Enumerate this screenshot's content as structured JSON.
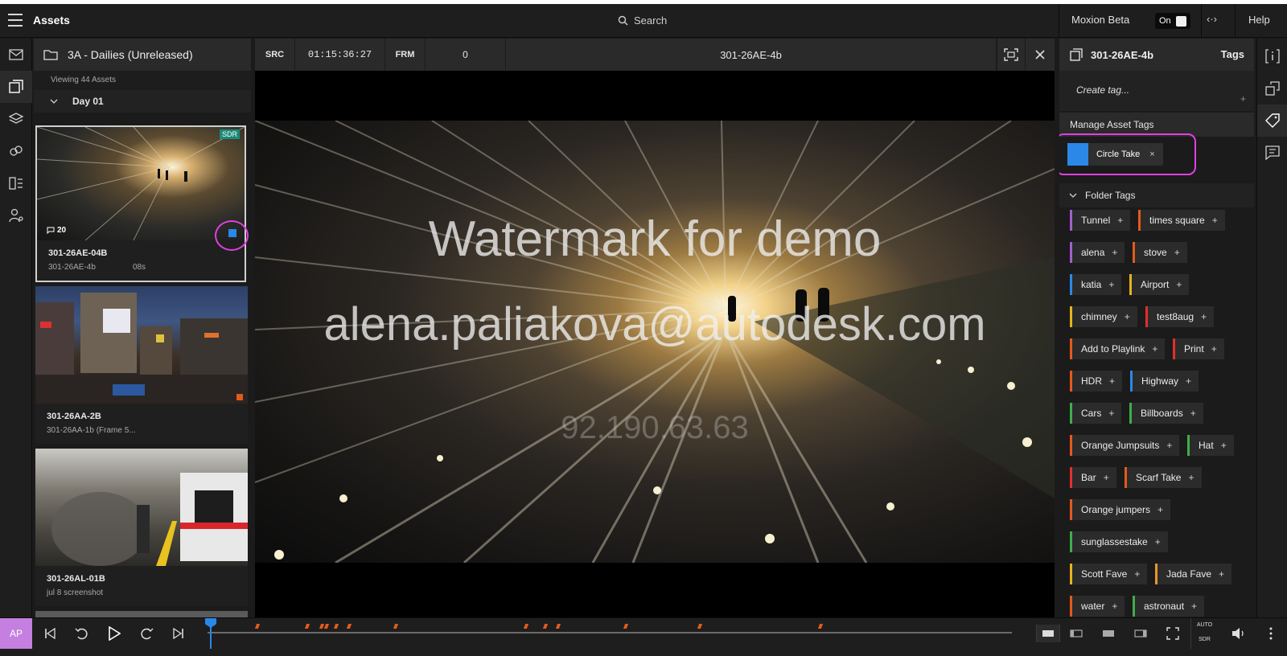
{
  "topbar": {
    "title": "Assets",
    "search_placeholder": "Search",
    "moxion_label": "Moxion Beta",
    "toggle_label": "On",
    "code_glyph": "‹·›",
    "help_label": "Help"
  },
  "assets_panel": {
    "folder_title": "3A - Dailies (Unreleased)",
    "viewing_text": "Viewing 44 Assets",
    "day_label": "Day 01",
    "cards": [
      {
        "name": "301-26AE-04B",
        "sub": "301-26AE-4b",
        "duration": "08s",
        "badge": "SDR",
        "comments": "20"
      },
      {
        "name": "301-26AA-2B",
        "sub": "301-26AA-1b (Frame 5...",
        "duration": ""
      },
      {
        "name": "301-26AL-01B",
        "sub": "jul 8 screenshot",
        "duration": ""
      }
    ]
  },
  "viewer": {
    "src_label": "SRC",
    "timecode": "01:15:36:27",
    "frm_label": "FRM",
    "frame_value": "0",
    "asset_name": "301-26AE-4b",
    "watermark_line1": "Watermark for demo",
    "watermark_line2": "alena.paliakova@autodesk.com",
    "watermark_ip": "92.190.63.63"
  },
  "tags_panel": {
    "asset_name": "301-26AE-4b",
    "tab_label": "Tags",
    "create_placeholder": "Create tag...",
    "create_plus": "+",
    "manage_label": "Manage Asset Tags",
    "asset_tag": {
      "name": "Circle Take",
      "color": "#2b88e8",
      "remove": "×"
    },
    "folder_tags_label": "Folder Tags",
    "folder_tags": [
      {
        "name": "Tunnel",
        "color": "#a35fd0"
      },
      {
        "name": "times square",
        "color": "#e45a1c"
      },
      {
        "name": "alena",
        "color": "#a35fd0"
      },
      {
        "name": "stove",
        "color": "#e45a1c"
      },
      {
        "name": "katia",
        "color": "#2b88e8"
      },
      {
        "name": "Airport",
        "color": "#e8b21c"
      },
      {
        "name": "chimney",
        "color": "#e8b21c"
      },
      {
        "name": "test8aug",
        "color": "#e0302c"
      },
      {
        "name": "Add to Playlink",
        "color": "#e45a1c"
      },
      {
        "name": "Print",
        "color": "#e0302c"
      },
      {
        "name": "HDR",
        "color": "#e45a1c"
      },
      {
        "name": "Highway",
        "color": "#2b88e8"
      },
      {
        "name": "Cars",
        "color": "#3fae4a"
      },
      {
        "name": "Billboards",
        "color": "#3fae4a"
      },
      {
        "name": "Orange Jumpsuits",
        "color": "#e45a1c"
      },
      {
        "name": "Hat",
        "color": "#3fae4a"
      },
      {
        "name": "Bar",
        "color": "#e0302c"
      },
      {
        "name": "Scarf Take",
        "color": "#e45a1c"
      },
      {
        "name": "Orange jumpers",
        "color": "#e45a1c"
      },
      {
        "name": "sunglassestake",
        "color": "#3fae4a"
      },
      {
        "name": "Scott Fave",
        "color": "#e8b21c"
      },
      {
        "name": "Jada Fave",
        "color": "#e8962c"
      },
      {
        "name": "water",
        "color": "#e45a1c"
      },
      {
        "name": "astronaut",
        "color": "#3fae4a"
      }
    ]
  },
  "bottom": {
    "avatar_initials": "AP",
    "auto_label": "AUTO",
    "sdr_label": "SDR"
  },
  "colors": {
    "accent": "#2b88e8",
    "highlight": "#e040e0",
    "marker": "#e45a1c"
  }
}
